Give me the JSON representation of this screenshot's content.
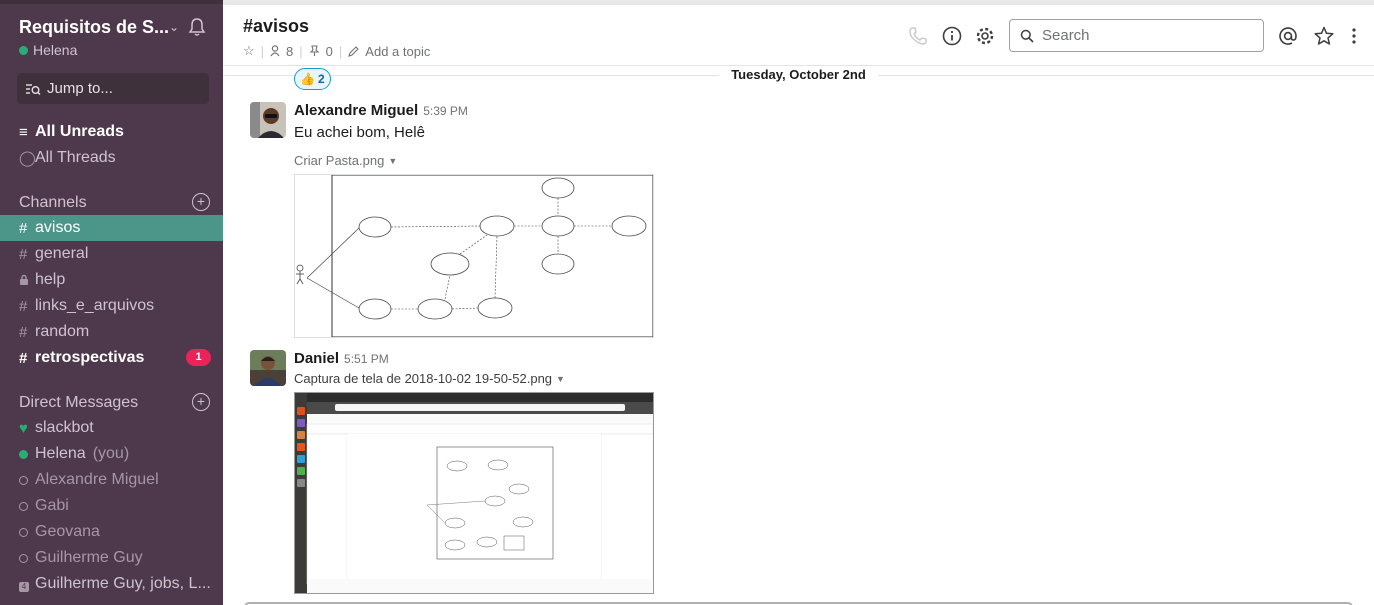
{
  "workspace": {
    "name": "Requisitos de S...",
    "user": "Helena"
  },
  "sidebar": {
    "jump_label": "Jump to...",
    "all_unreads": "All Unreads",
    "all_threads": "All Threads",
    "channels_title": "Channels",
    "channels": [
      {
        "name": "avisos",
        "glyph": "#",
        "active": true
      },
      {
        "name": "general",
        "glyph": "#"
      },
      {
        "name": "help",
        "glyph": "lock"
      },
      {
        "name": "links_e_arquivos",
        "glyph": "#"
      },
      {
        "name": "random",
        "glyph": "#"
      },
      {
        "name": "retrospectivas",
        "glyph": "#",
        "bold": true,
        "badge": "1"
      }
    ],
    "dm_title": "Direct Messages",
    "dms": [
      {
        "name": "slackbot",
        "status": "heart"
      },
      {
        "name": "Helena",
        "suffix": "(you)",
        "status": "online"
      },
      {
        "name": "Alexandre Miguel",
        "status": "away"
      },
      {
        "name": "Gabi",
        "status": "away"
      },
      {
        "name": "Geovana",
        "status": "away"
      },
      {
        "name": "Guilherme Guy",
        "status": "away"
      },
      {
        "name": "Guilherme Guy, jobs, L...",
        "status": "group",
        "group_count": "4"
      }
    ]
  },
  "header": {
    "channel": "#avisos",
    "members": "8",
    "pins": "0",
    "add_topic": "Add a topic",
    "search_placeholder": "Search"
  },
  "messages": {
    "day": "Tuesday, October 2nd",
    "reaction": {
      "emoji": "👍",
      "count": "2"
    },
    "items": [
      {
        "author": "Alexandre Miguel",
        "time": "5:39 PM",
        "text": "Eu achei bom, Helê",
        "file": "Criar Pasta.png"
      },
      {
        "author": "Daniel",
        "time": "5:51 PM",
        "file": "Captura de tela de 2018-10-02 19-50-52.png"
      }
    ]
  },
  "colors": {
    "sidebar_bg": "#4d394b",
    "active_channel": "#4c9689",
    "badge": "#e8245a",
    "presence": "#2bac76"
  }
}
